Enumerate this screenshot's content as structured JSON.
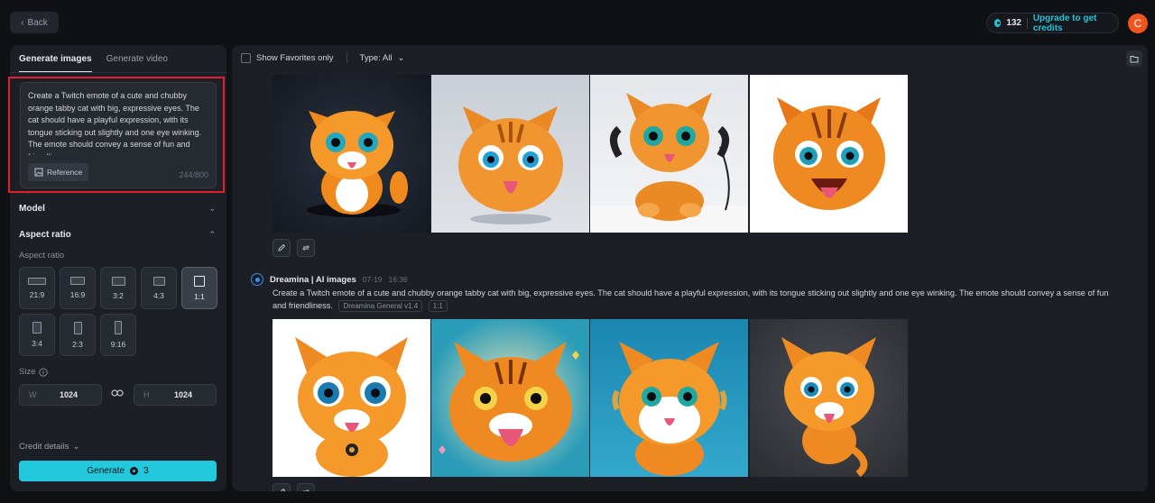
{
  "header": {
    "back_label": "Back",
    "credits": "132",
    "upgrade_label": "Upgrade to get credits",
    "avatar_initial": "C"
  },
  "left": {
    "tabs": [
      {
        "label": "Generate images",
        "active": true
      },
      {
        "label": "Generate video",
        "active": false
      }
    ],
    "prompt_text": "Create a Twitch emote of a cute and chubby orange tabby cat with big, expressive eyes. The cat should have a playful expression, with its tongue sticking out slightly and one eye winking. The emote should convey a sense of fun and friendliness.",
    "reference_label": "Reference",
    "char_count": "244/800",
    "model_label": "Model",
    "aspect_title": "Aspect ratio",
    "aspect_sublabel": "Aspect ratio",
    "ratios": [
      "21:9",
      "16:9",
      "3:2",
      "4:3",
      "1:1",
      "3:4",
      "2:3",
      "9:16"
    ],
    "selected_ratio": "1:1",
    "size_label": "Size",
    "width_label": "W",
    "width_value": "1024",
    "height_label": "H",
    "height_value": "1024",
    "credit_details_label": "Credit details",
    "generate_label": "Generate",
    "generate_cost": "3"
  },
  "right": {
    "favorites_label": "Show Favorites only",
    "type_label": "Type: All",
    "generation": {
      "author": "Dreamina | AI images",
      "date": "07-19",
      "time": "16:36",
      "prompt": "Create a Twitch emote of a cute and chubby orange tabby cat with big, expressive eyes. The cat should have a playful expression, with its tongue sticking out slightly and one eye winking. The emote should convey a sense of fun and friendliness.",
      "model_tag": "Dreamina General v1.4",
      "ratio_tag": "1:1"
    },
    "colors": {
      "accent": "#22c9dc",
      "cat_orange": "#f08a1c",
      "highlight_frame": "#e0212b"
    }
  }
}
